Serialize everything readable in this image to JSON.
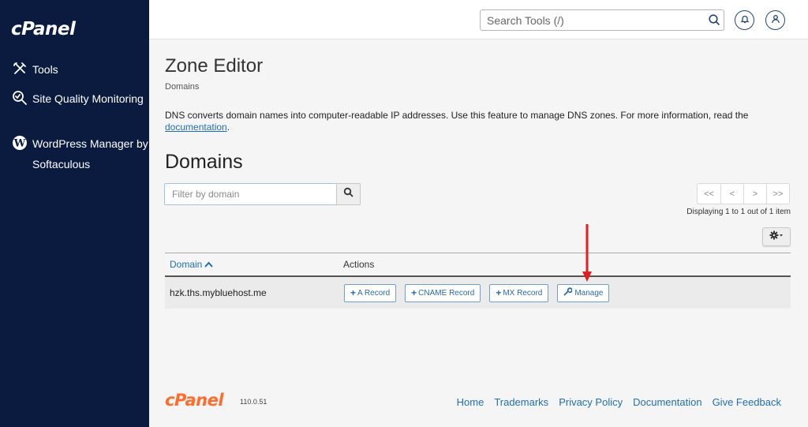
{
  "sidebar": {
    "logo": "cPanel",
    "items": [
      {
        "label": "Tools",
        "icon": "tools-icon"
      },
      {
        "label": "Site Quality Monitoring",
        "icon": "site-quality-icon"
      },
      {
        "label": "WordPress Manager by Softaculous",
        "icon": "wordpress-icon"
      }
    ]
  },
  "topbar": {
    "search_placeholder": "Search Tools (/)",
    "icons": [
      "search-icon",
      "bell-icon",
      "user-icon"
    ]
  },
  "page": {
    "title": "Zone Editor",
    "breadcrumb": "Domains",
    "description": "DNS converts domain names into computer-readable IP addresses. Use this feature to manage DNS zones. For more information, read the",
    "description_link": "documentation",
    "description_end": "."
  },
  "domains": {
    "title": "Domains",
    "filter_placeholder": "Filter by domain",
    "pager": [
      "<<",
      "<",
      ">",
      ">>"
    ],
    "displaying": "Displaying 1 to 1 out of 1 item",
    "columns": {
      "domain": "Domain",
      "actions": "Actions"
    },
    "rows": [
      {
        "domain": "hzk.ths.mybluehost.me",
        "actions": [
          "A Record",
          "CNAME Record",
          "MX Record",
          "Manage"
        ]
      }
    ]
  },
  "annotation": {
    "arrow_color": "#e02020",
    "target": "Manage"
  },
  "footer": {
    "logo": "cPanel",
    "version": "110.0.51",
    "links": [
      "Home",
      "Trademarks",
      "Privacy Policy",
      "Documentation",
      "Give Feedback"
    ]
  },
  "colors": {
    "sidebar_bg": "#0a1b3f",
    "link": "#1f6fb2",
    "brand_orange": "#ff6c2c"
  }
}
